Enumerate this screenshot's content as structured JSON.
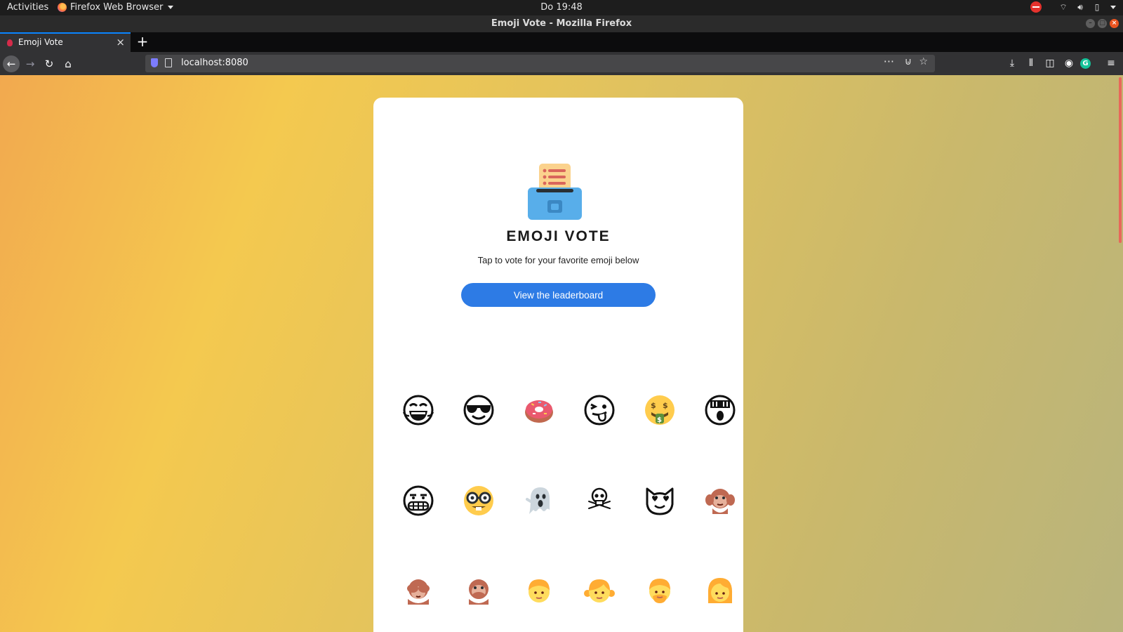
{
  "system_bar": {
    "activities": "Activities",
    "app_menu": "Firefox Web Browser",
    "clock": "Do 19:48"
  },
  "window": {
    "title": "Emoji Vote - Mozilla Firefox"
  },
  "browser": {
    "tab_title": "Emoji Vote",
    "url": "localhost:8080"
  },
  "page": {
    "heading": "EMOJI VOTE",
    "subheading": "Tap to vote for your favorite emoji below",
    "leaderboard_button": "View the leaderboard",
    "emojis": [
      "rolling-on-the-floor-laughing",
      "smiling-face-with-sunglasses",
      "doughnut",
      "winking-face-with-tongue",
      "money-mouth-face",
      "face-screaming",
      "grimacing-face",
      "nerd-face",
      "ghost",
      "skull-and-crossbones",
      "smiling-cat-with-heart-eyes",
      "hear-no-evil-monkey",
      "see-no-evil-monkey",
      "speak-no-evil-monkey",
      "boy",
      "girl",
      "man",
      "woman"
    ]
  },
  "colors": {
    "button": "#2d7be5",
    "card": "#ffffff",
    "gradient_left": "#f2a94f",
    "gradient_right": "#b9b47c"
  }
}
